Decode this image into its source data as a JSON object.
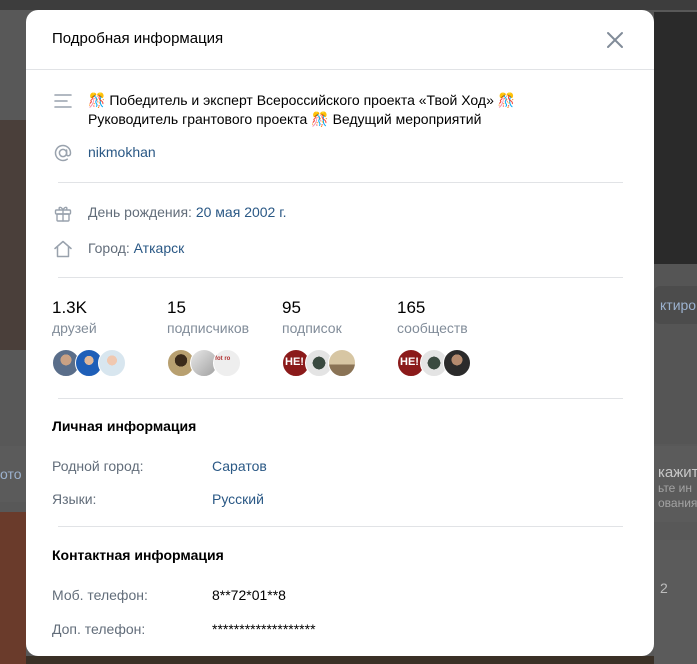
{
  "background": {
    "right_button_label": "ктиро",
    "right_block_title": "кажит",
    "right_block_sub1": "ьте ин",
    "right_block_sub2": "ования",
    "right_bottom_text": "2",
    "left_block_label": "ото"
  },
  "modal": {
    "title": "Подробная информация",
    "close_icon": "close-icon",
    "status_line1": "Победитель и эксперт Всероссийского проекта «Твой Ход»",
    "status_line2_a": "Руководитель грантового проекта",
    "status_line2_b": "Ведущий мероприятий",
    "status_emoji": "🎊",
    "username": "nikmokhan",
    "birthday_label": "День рождения:",
    "birthday_value": "20 мая 2002 г.",
    "city_label": "Город:",
    "city_value": "Аткарск"
  },
  "stats": [
    {
      "count": "1.3K",
      "label": "друзей"
    },
    {
      "count": "15",
      "label": "подписчиков"
    },
    {
      "count": "95",
      "label": "подписок"
    },
    {
      "count": "165",
      "label": "сообществ"
    }
  ],
  "personal": {
    "title": "Личная информация",
    "hometown_label": "Родной город:",
    "hometown_value": "Саратов",
    "languages_label": "Языки:",
    "languages_value": "Русский"
  },
  "contacts": {
    "title": "Контактная информация",
    "mobile_label": "Моб. телефон:",
    "mobile_value": "8**72*01**8",
    "extra_label": "Доп. телефон:",
    "extra_value": "*******************"
  },
  "avatar_badges": {
    "he_badge": "НЕ!",
    "vlog_badge": "fot ro"
  },
  "colors": {
    "link": "#2a5885",
    "gray_label": "#626d7a",
    "stat_label": "#818c99",
    "icon": "#99a2ad"
  }
}
